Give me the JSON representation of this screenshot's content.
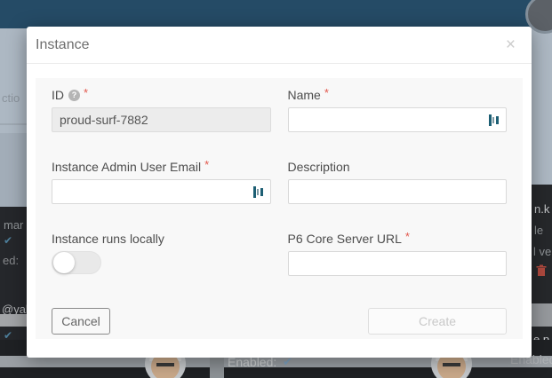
{
  "colors": {
    "header_bar": "#254b66",
    "backdrop_dim": "#adb8c3",
    "required_marker": "#e2574c",
    "autofill_icon_teal": "#1d5f74",
    "panel_bg": "#f8f8f8"
  },
  "modal": {
    "title": "Instance",
    "close_icon": "×",
    "required_marker": "*",
    "help_icon": "?",
    "fields": {
      "id": {
        "label": "ID",
        "value": "proud-surf-7882"
      },
      "name": {
        "label": "Name",
        "value": ""
      },
      "admin_email": {
        "label": "Instance Admin User Email",
        "value": ""
      },
      "description": {
        "label": "Description",
        "value": ""
      },
      "runs_locally": {
        "label": "Instance runs locally",
        "state": "off"
      },
      "p6_url": {
        "label": "P6 Core Server URL",
        "value": ""
      }
    },
    "buttons": {
      "cancel": "Cancel",
      "create": "Create"
    }
  },
  "background": {
    "left": {
      "frag_actions": "ctio",
      "frag_mar": "mar",
      "check": "✔",
      "frag_ed": "ed:",
      "frag_email": "@yah",
      "check2": "✔",
      "arrow": "▸"
    },
    "right": {
      "frag_nk": "n.k",
      "frag_le": "le",
      "frag_lve": "l ve",
      "frag_ep": "e.p",
      "frag_enabled": "Enabled"
    },
    "bottom": {
      "enabled_label": "Enabled:",
      "check": "✔"
    }
  }
}
